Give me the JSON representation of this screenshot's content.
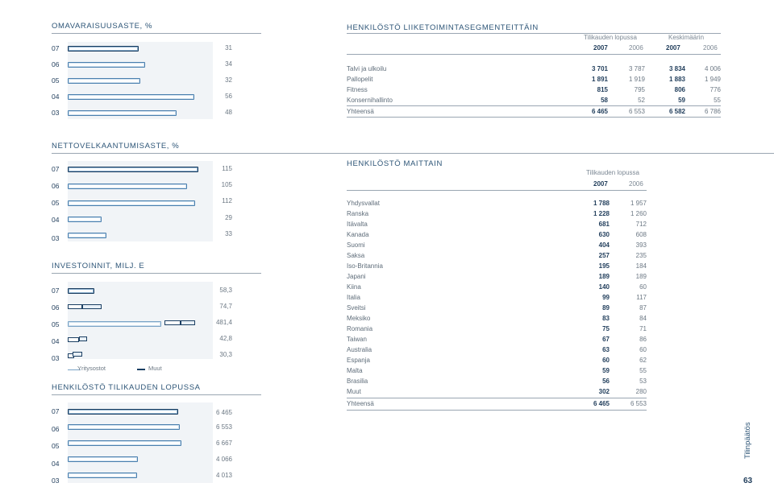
{
  "equity_ratio": {
    "title": "OMAVARAISUUSASTE, %",
    "rows": [
      {
        "year": "07",
        "value": "31"
      },
      {
        "year": "06",
        "value": "34"
      },
      {
        "year": "05",
        "value": "32"
      },
      {
        "year": "04",
        "value": "56"
      },
      {
        "year": "03",
        "value": "48"
      }
    ]
  },
  "net_gearing": {
    "title": "NETTOVELKAANTUMISASTE, %",
    "rows": [
      {
        "year": "07",
        "value": "115"
      },
      {
        "year": "06",
        "value": "105"
      },
      {
        "year": "05",
        "value": "112"
      },
      {
        "year": "04",
        "value": "29"
      },
      {
        "year": "03",
        "value": "33"
      }
    ]
  },
  "investments": {
    "title": "INVESTOINNIT, MILJ. E",
    "rows": [
      {
        "year": "07",
        "value": "58,3"
      },
      {
        "year": "06",
        "value": "74,7"
      },
      {
        "year": "05",
        "value": "481,4"
      },
      {
        "year": "04",
        "value": "42,8"
      },
      {
        "year": "03",
        "value": "30,3"
      }
    ],
    "legend": {
      "acquisitions": "Yritysostot",
      "other": "Muut"
    }
  },
  "personnel_year_end": {
    "title": "HENKILÖSTÖ TILIKAUDEN LOPUSSA",
    "rows": [
      {
        "year": "07",
        "value": "6 465"
      },
      {
        "year": "06",
        "value": "6 553"
      },
      {
        "year": "05",
        "value": "6 667"
      },
      {
        "year": "04",
        "value": "4 066"
      },
      {
        "year": "03",
        "value": "4 013"
      }
    ]
  },
  "personnel_by_segment": {
    "title": "HENKILÖSTÖ LIIKETOIMINTASEGMENTEITTÄIN",
    "group1": "Tilikauden lopussa",
    "group2": "Keskimäärin",
    "years": [
      "2007",
      "2006",
      "2007",
      "2006"
    ],
    "rows": [
      {
        "label": "Talvi ja ulkoilu",
        "c1": "3 701",
        "c2": "3 787",
        "c3": "3 834",
        "c4": "4 006"
      },
      {
        "label": "Pallopelit",
        "c1": "1 891",
        "c2": "1 919",
        "c3": "1 883",
        "c4": "1 949"
      },
      {
        "label": "Fitness",
        "c1": "815",
        "c2": "795",
        "c3": "806",
        "c4": "776"
      },
      {
        "label": "Konsernihallinto",
        "c1": "58",
        "c2": "52",
        "c3": "59",
        "c4": "55"
      },
      {
        "label": "Yhteensä",
        "c1": "6 465",
        "c2": "6 553",
        "c3": "6 582",
        "c4": "6 786"
      }
    ]
  },
  "personnel_by_country": {
    "title": "HENKILÖSTÖ MAITTAIN",
    "group": "Tilikauden lopussa",
    "years": [
      "2007",
      "2006"
    ],
    "rows": [
      {
        "label": "Yhdysvallat",
        "c1": "1 788",
        "c2": "1 957"
      },
      {
        "label": "Ranska",
        "c1": "1 228",
        "c2": "1 260"
      },
      {
        "label": "Itävalta",
        "c1": "681",
        "c2": "712"
      },
      {
        "label": "Kanada",
        "c1": "630",
        "c2": "608"
      },
      {
        "label": "Suomi",
        "c1": "404",
        "c2": "393"
      },
      {
        "label": "Saksa",
        "c1": "257",
        "c2": "235"
      },
      {
        "label": "Iso-Britannia",
        "c1": "195",
        "c2": "184"
      },
      {
        "label": "Japani",
        "c1": "189",
        "c2": "189"
      },
      {
        "label": "Kiina",
        "c1": "140",
        "c2": "60"
      },
      {
        "label": "Italia",
        "c1": "99",
        "c2": "117"
      },
      {
        "label": "Sveitsi",
        "c1": "89",
        "c2": "87"
      },
      {
        "label": "Meksiko",
        "c1": "83",
        "c2": "84"
      },
      {
        "label": "Romania",
        "c1": "75",
        "c2": "71"
      },
      {
        "label": "Taiwan",
        "c1": "67",
        "c2": "86"
      },
      {
        "label": "Australia",
        "c1": "63",
        "c2": "60"
      },
      {
        "label": "Espanja",
        "c1": "60",
        "c2": "62"
      },
      {
        "label": "Malta",
        "c1": "59",
        "c2": "55"
      },
      {
        "label": "Brasilia",
        "c1": "56",
        "c2": "53"
      },
      {
        "label": "Muut",
        "c1": "302",
        "c2": "280"
      }
    ],
    "total": {
      "label": "Yhteensä",
      "c1": "6 465",
      "c2": "6 553"
    }
  },
  "side_label": "Tilinpäätös",
  "page_number": "63"
}
